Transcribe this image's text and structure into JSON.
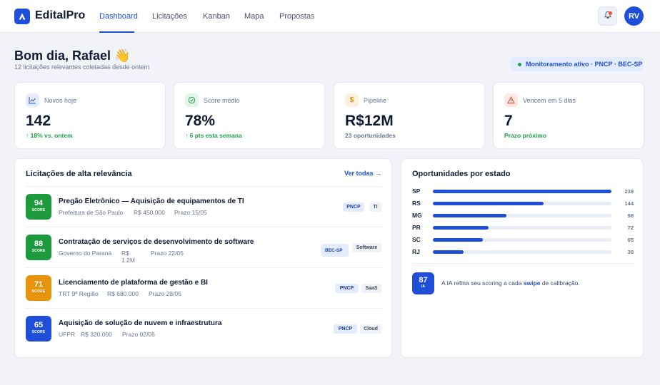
{
  "app": {
    "name": "EditalPro"
  },
  "nav": {
    "items": [
      {
        "label": "Dashboard",
        "active": true
      },
      {
        "label": "Licitações"
      },
      {
        "label": "Kanban"
      },
      {
        "label": "Mapa"
      },
      {
        "label": "Propostas"
      }
    ]
  },
  "user": {
    "initials": "RV",
    "has_notification": true
  },
  "greeting": {
    "title": "Bom dia, Rafael 👋",
    "subtitle": "12 licitações relevantes coletadas desde ontem",
    "monitor": "Monitoramento ativo · PNCP · BEC-SP"
  },
  "stats": [
    {
      "icon": "trend-chart-icon",
      "label": "Novos hoje",
      "value": "142",
      "foot": "↑ 18% vs. ontem",
      "foot_color": "#1fa34a",
      "icon_bg": "#e6edfc",
      "icon_color": "#1f4fd8"
    },
    {
      "icon": "check-circle-icon",
      "label": "Score médio",
      "value": "78%",
      "foot": "↑ 6 pts esta semana",
      "foot_color": "#1fa34a",
      "icon_bg": "#e3f5e8",
      "icon_color": "#1fa34a"
    },
    {
      "icon": "dollar-icon",
      "label": "Pipeline",
      "value": "R$12M",
      "foot": "23 oportunidades",
      "foot_color": "#6b7591",
      "icon_bg": "#fdf0e0",
      "icon_color": "#e08a10"
    },
    {
      "icon": "warning-icon",
      "label": "Vencem em 5 dias",
      "value": "7",
      "foot": "Prazo próximo",
      "foot_color": "#1fa34a",
      "icon_bg": "#fde8e6",
      "icon_color": "#e0402e"
    }
  ],
  "relevance": {
    "title": "Licitações de alta relevância",
    "see_all": "Ver todas →",
    "score_label": "SCORE",
    "rows": [
      {
        "score": "94",
        "color": "#1e9a3e",
        "title": "Pregão Eletrônico — Aquisição de equipamentos de TI",
        "org": "Prefeitura de São Paulo",
        "value": "R$ 450.000",
        "deadline": "Prazo 15/05",
        "tags": [
          "PNCP",
          "TI"
        ]
      },
      {
        "score": "88",
        "color": "#1e9a3e",
        "title": "Contratação de serviços de desenvolvimento de software",
        "org": "Governo do Paraná",
        "value": "R$ 1.2M",
        "deadline": "Prazo 22/05",
        "tags": [
          "BEC-SP",
          "Software"
        ]
      },
      {
        "score": "71",
        "color": "#e8930e",
        "title": "Licenciamento de plataforma de gestão e BI",
        "org": "TRT 9ª Região",
        "value": "R$ 680.000",
        "deadline": "Prazo 28/05",
        "tags": [
          "PNCP",
          "SaaS"
        ]
      },
      {
        "score": "65",
        "color": "#1f4fd8",
        "title": "Aquisição de solução de nuvem e infraestrutura",
        "org": "UFPR",
        "value": "R$ 320.000",
        "deadline": "Prazo 02/06",
        "tags": [
          "PNCP",
          "Cloud"
        ]
      }
    ]
  },
  "states": {
    "title": "Oportunidades por estado",
    "items": [
      {
        "state": "SP",
        "count": "238",
        "fraction": 1.0
      },
      {
        "state": "RS",
        "count": "144",
        "fraction": 0.62
      },
      {
        "state": "MG",
        "count": "98",
        "fraction": 0.41
      },
      {
        "state": "PR",
        "count": "72",
        "fraction": 0.31
      },
      {
        "state": "SC",
        "count": "65",
        "fraction": 0.28
      },
      {
        "state": "RJ",
        "count": "39",
        "fraction": 0.17
      }
    ],
    "ia": {
      "score": "87",
      "label": "IA",
      "text_before": "A IA refina seu scoring a cada ",
      "text_bold": "swipe",
      "text_after": " de calibração."
    }
  }
}
